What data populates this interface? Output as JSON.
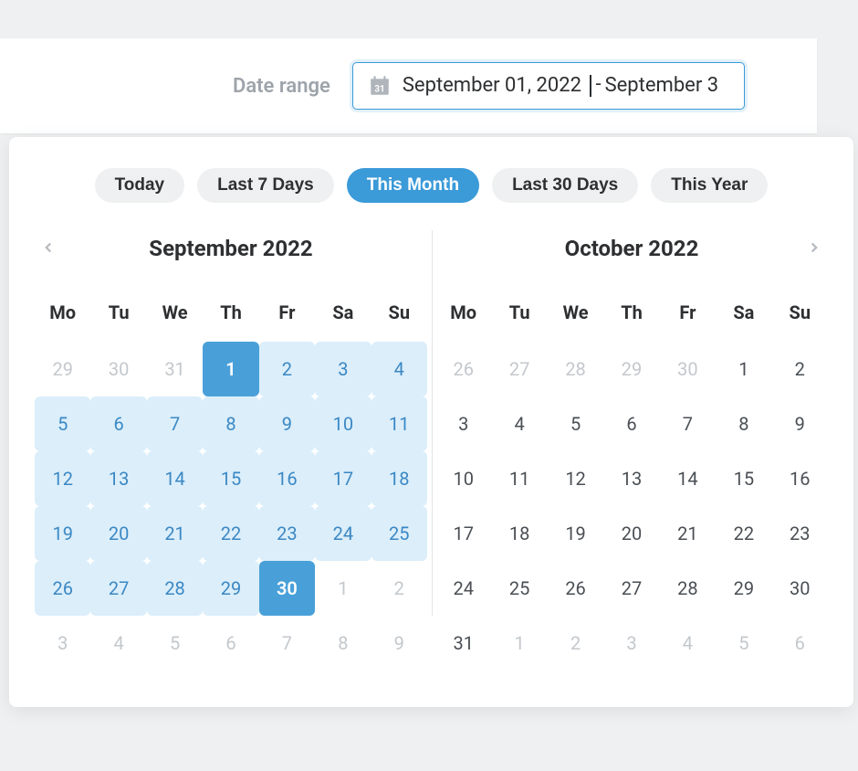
{
  "header": {
    "label": "Date range",
    "input_display_start": "September 01, 2022",
    "input_display_end": "September 3"
  },
  "presets": [
    {
      "label": "Today",
      "active": false
    },
    {
      "label": "Last 7 Days",
      "active": false
    },
    {
      "label": "This Month",
      "active": true
    },
    {
      "label": "Last 30 Days",
      "active": false
    },
    {
      "label": "This Year",
      "active": false
    }
  ],
  "dow": [
    "Mo",
    "Tu",
    "We",
    "Th",
    "Fr",
    "Sa",
    "Su"
  ],
  "range": {
    "start": "2022-09-01",
    "end": "2022-09-30"
  },
  "months": [
    {
      "title": "September 2022",
      "nav_prev": true,
      "nav_next": false,
      "weeks": [
        [
          {
            "d": 29,
            "other": true
          },
          {
            "d": 30,
            "other": true
          },
          {
            "d": 31,
            "other": true
          },
          {
            "d": 1,
            "start": true
          },
          {
            "d": 2,
            "in": true
          },
          {
            "d": 3,
            "in": true
          },
          {
            "d": 4,
            "in": true
          }
        ],
        [
          {
            "d": 5,
            "in": true
          },
          {
            "d": 6,
            "in": true
          },
          {
            "d": 7,
            "in": true
          },
          {
            "d": 8,
            "in": true
          },
          {
            "d": 9,
            "in": true
          },
          {
            "d": 10,
            "in": true
          },
          {
            "d": 11,
            "in": true
          }
        ],
        [
          {
            "d": 12,
            "in": true
          },
          {
            "d": 13,
            "in": true
          },
          {
            "d": 14,
            "in": true
          },
          {
            "d": 15,
            "in": true
          },
          {
            "d": 16,
            "in": true
          },
          {
            "d": 17,
            "in": true
          },
          {
            "d": 18,
            "in": true
          }
        ],
        [
          {
            "d": 19,
            "in": true
          },
          {
            "d": 20,
            "in": true
          },
          {
            "d": 21,
            "in": true
          },
          {
            "d": 22,
            "in": true
          },
          {
            "d": 23,
            "in": true
          },
          {
            "d": 24,
            "in": true
          },
          {
            "d": 25,
            "in": true
          }
        ],
        [
          {
            "d": 26,
            "in": true
          },
          {
            "d": 27,
            "in": true
          },
          {
            "d": 28,
            "in": true
          },
          {
            "d": 29,
            "in": true
          },
          {
            "d": 30,
            "end": true
          },
          {
            "d": 1,
            "other": true
          },
          {
            "d": 2,
            "other": true
          }
        ],
        [
          {
            "d": 3,
            "other": true
          },
          {
            "d": 4,
            "other": true
          },
          {
            "d": 5,
            "other": true
          },
          {
            "d": 6,
            "other": true
          },
          {
            "d": 7,
            "other": true
          },
          {
            "d": 8,
            "other": true
          },
          {
            "d": 9,
            "other": true
          }
        ]
      ]
    },
    {
      "title": "October 2022",
      "nav_prev": false,
      "nav_next": true,
      "weeks": [
        [
          {
            "d": 26,
            "other": true
          },
          {
            "d": 27,
            "other": true
          },
          {
            "d": 28,
            "other": true
          },
          {
            "d": 29,
            "other": true
          },
          {
            "d": 30,
            "other": true
          },
          {
            "d": 1
          },
          {
            "d": 2
          }
        ],
        [
          {
            "d": 3
          },
          {
            "d": 4
          },
          {
            "d": 5
          },
          {
            "d": 6
          },
          {
            "d": 7
          },
          {
            "d": 8
          },
          {
            "d": 9
          }
        ],
        [
          {
            "d": 10
          },
          {
            "d": 11
          },
          {
            "d": 12
          },
          {
            "d": 13
          },
          {
            "d": 14
          },
          {
            "d": 15
          },
          {
            "d": 16
          }
        ],
        [
          {
            "d": 17
          },
          {
            "d": 18
          },
          {
            "d": 19
          },
          {
            "d": 20
          },
          {
            "d": 21
          },
          {
            "d": 22
          },
          {
            "d": 23
          }
        ],
        [
          {
            "d": 24
          },
          {
            "d": 25
          },
          {
            "d": 26
          },
          {
            "d": 27
          },
          {
            "d": 28
          },
          {
            "d": 29
          },
          {
            "d": 30
          }
        ],
        [
          {
            "d": 31
          },
          {
            "d": 1,
            "other": true
          },
          {
            "d": 2,
            "other": true
          },
          {
            "d": 3,
            "other": true
          },
          {
            "d": 4,
            "other": true
          },
          {
            "d": 5,
            "other": true
          },
          {
            "d": 6,
            "other": true
          }
        ]
      ]
    }
  ]
}
